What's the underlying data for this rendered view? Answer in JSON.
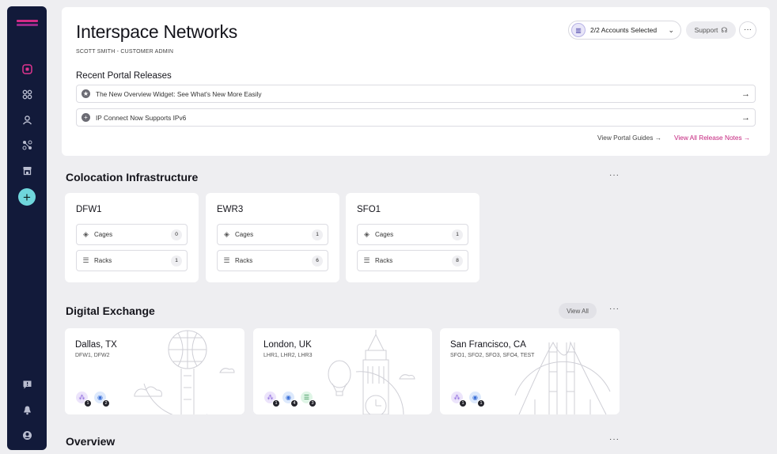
{
  "sidebar": {
    "items": [
      {
        "name": "overview",
        "icon": "target-icon"
      },
      {
        "name": "services",
        "icon": "grid-icon"
      },
      {
        "name": "users",
        "icon": "user-icon"
      },
      {
        "name": "connections",
        "icon": "nodes-icon"
      },
      {
        "name": "marketplace",
        "icon": "store-icon"
      }
    ],
    "add_icon": "plus-icon",
    "bottom_items": [
      {
        "name": "feedback",
        "icon": "chat-icon"
      },
      {
        "name": "notifications",
        "icon": "bell-icon"
      },
      {
        "name": "account",
        "icon": "user-circle-icon"
      }
    ],
    "accent": "#e0348f"
  },
  "header": {
    "title": "Interspace Networks",
    "subtitle": "SCOTT SMITH - CUSTOMER ADMIN",
    "accounts_label": "2/2 Accounts Selected",
    "support_label": "Support",
    "more_label": "···"
  },
  "releases": {
    "heading": "Recent Portal Releases",
    "items": [
      {
        "text": "The New Overview Widget: See What's New More Easily",
        "icon": "star-icon"
      },
      {
        "text": "IP Connect Now Supports IPv6",
        "icon": "plus-circle-icon"
      }
    ],
    "guides_link": "View Portal Guides →",
    "notes_link": "View All Release Notes →",
    "link_color": "#c4227d"
  },
  "colocation": {
    "title": "Colocation Infrastructure",
    "more": "···",
    "sites": [
      {
        "name": "DFW1",
        "cages_label": "Cages",
        "cages": "0",
        "racks_label": "Racks",
        "racks": "1"
      },
      {
        "name": "EWR3",
        "cages_label": "Cages",
        "cages": "1",
        "racks_label": "Racks",
        "racks": "6"
      },
      {
        "name": "SFO1",
        "cages_label": "Cages",
        "cages": "1",
        "racks_label": "Racks",
        "racks": "8"
      }
    ]
  },
  "exchange": {
    "title": "Digital Exchange",
    "view_all": "View All",
    "more": "···",
    "cities": [
      {
        "city": "Dallas, TX",
        "codes": "DFW1, DFW2",
        "counts": [
          "1",
          "2"
        ]
      },
      {
        "city": "London, UK",
        "codes": "LHR1, LHR2, LHR3",
        "counts": [
          "1",
          "4",
          "3"
        ]
      },
      {
        "city": "San Francisco, CA",
        "codes": "SFO1, SFO2, SFO3, SFO4, TEST",
        "counts": [
          "1",
          "1"
        ]
      }
    ]
  },
  "overview": {
    "title": "Overview",
    "more": "···"
  }
}
